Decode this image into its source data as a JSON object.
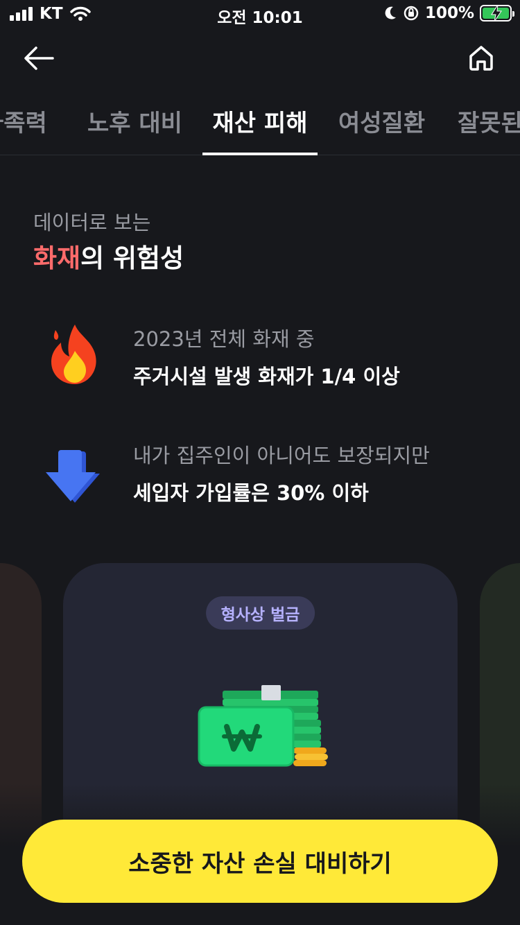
{
  "status_bar": {
    "carrier": "KT",
    "time": "오전 10:01",
    "battery": "100%",
    "icons": [
      "signal-icon",
      "wifi-icon",
      "moon-icon",
      "orientation-lock-icon",
      "battery-charging-icon"
    ]
  },
  "header": {
    "back_icon": "arrow-left-icon",
    "home_icon": "home-icon"
  },
  "tabs": [
    {
      "label": "가족력",
      "active": false
    },
    {
      "label": "노후 대비",
      "active": false
    },
    {
      "label": "재산 피해",
      "active": true
    },
    {
      "label": "여성질환",
      "active": false
    },
    {
      "label": "잘못된",
      "active": false
    }
  ],
  "headline": {
    "subtitle": "데이터로 보는",
    "title_accent": "화재",
    "title_rest": "의 위험성",
    "accent_color": "#ff6b6b"
  },
  "facts": [
    {
      "icon": "fire-icon",
      "line1": "2023년 전체 화재 중",
      "line2": "주거시설 발생 화재가 1/4 이상"
    },
    {
      "icon": "arrow-down-icon",
      "line1": "내가 집주인이 아니어도 보장되지만",
      "line2": "세입자 가입률은 30% 이하"
    }
  ],
  "carousel": {
    "active_card": {
      "badge": "형사상 벌금",
      "illustration": "won-money-stack-icon"
    }
  },
  "cta": {
    "label": "소중한 자산 손실 대비하기",
    "color": "#ffe938"
  }
}
